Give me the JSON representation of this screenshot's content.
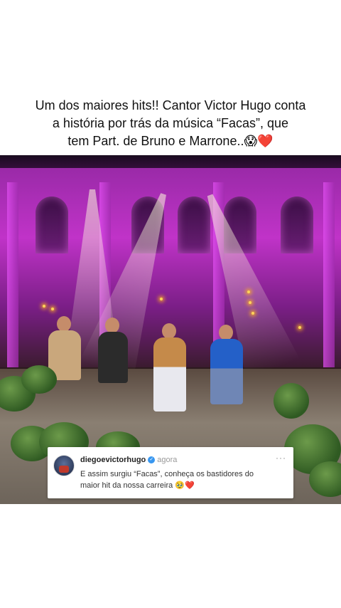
{
  "caption": {
    "line1": "Um dos maiores hits!! Cantor Victor Hugo conta",
    "line2": "a história por trás da música “Facas”, que",
    "line3": "tem Part. de Bruno e Marrone..😱❤️"
  },
  "comment": {
    "username": "diegoevictorhugo",
    "verified_icon": "✓",
    "time": "agora",
    "more_icon": "···",
    "line1": "E assim surgiu “Facas”, conheça os bastidores do",
    "line2": "maior hit da nossa carreira 🥹❤️"
  },
  "colors": {
    "stage_purple": "#c033c8",
    "verified_blue": "#3897f0"
  }
}
